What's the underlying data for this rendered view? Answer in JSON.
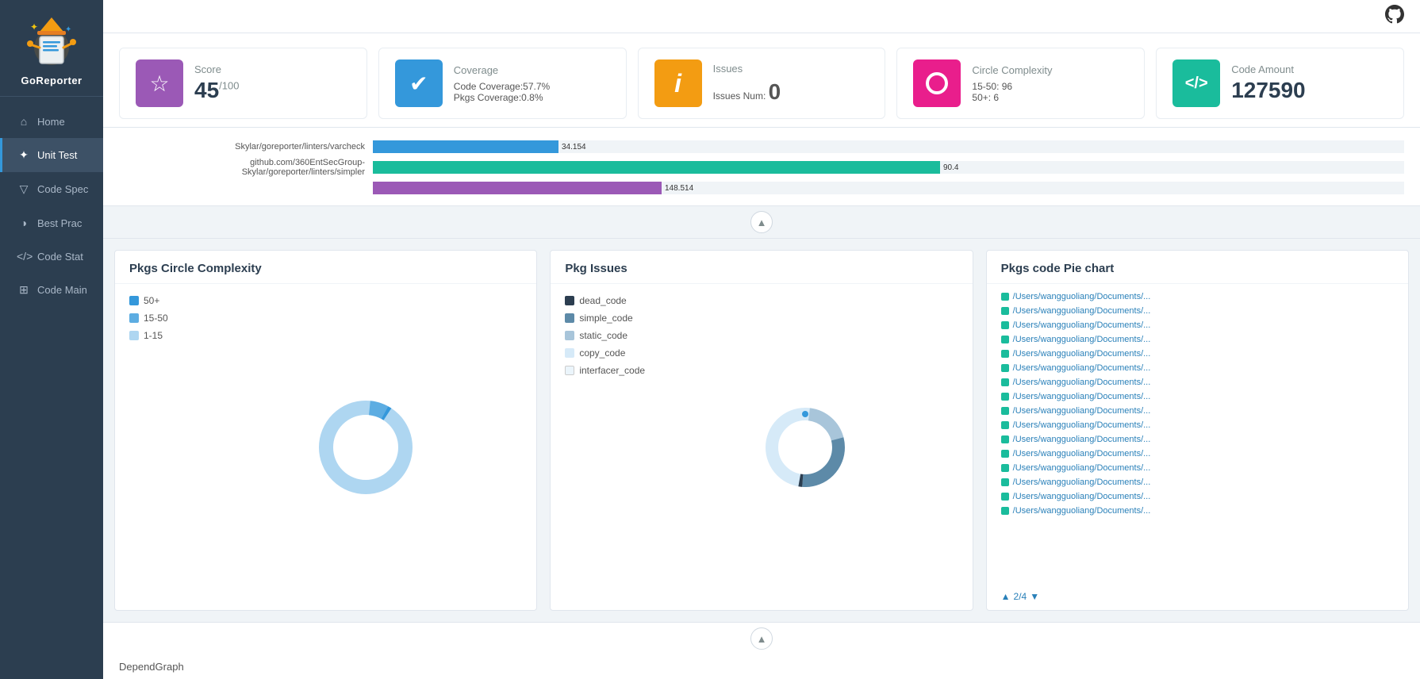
{
  "sidebar": {
    "title": "GoReporter",
    "nav_items": [
      {
        "id": "home",
        "label": "Home",
        "icon": "⌂",
        "active": false
      },
      {
        "id": "unit-test",
        "label": "Unit Test",
        "icon": "✦",
        "active": true
      },
      {
        "id": "code-spec",
        "label": "Code Spec",
        "icon": "▽",
        "active": false
      },
      {
        "id": "best-prac",
        "label": "Best Prac",
        "icon": "◑",
        "active": false
      },
      {
        "id": "code-stat",
        "label": "Code Stat",
        "icon": "</>",
        "active": false
      },
      {
        "id": "code-main",
        "label": "Code Main",
        "icon": "⊞",
        "active": false
      }
    ]
  },
  "topbar": {
    "github_icon": "github"
  },
  "stats": [
    {
      "id": "score",
      "label": "Score",
      "value": "45",
      "sup": "/100",
      "icon": "☆",
      "color": "purple",
      "sub": null
    },
    {
      "id": "coverage",
      "label": "Coverage",
      "value": null,
      "icon": "✔",
      "color": "blue",
      "sub": "Code Coverage:57.7%\nPkgs Coverage:0.8%"
    },
    {
      "id": "issues",
      "label": "Issues",
      "value": "0",
      "icon": "ℹ",
      "color": "orange",
      "sub": "Issues Num:"
    },
    {
      "id": "circle-complexity",
      "label": "Circle Complexity",
      "value": null,
      "icon": "◎",
      "color": "pink",
      "sub": "15-50: 96\n50+: 6"
    },
    {
      "id": "code-amount",
      "label": "Code Amount",
      "value": "127590",
      "icon": "</>",
      "color": "teal",
      "sub": null
    }
  ],
  "bar_chart": {
    "rows": [
      {
        "label": "Skylar/goreporter/linters/varcheck",
        "value": "34.154",
        "width_pct": 18,
        "color": "#3498db"
      },
      {
        "label": "github.com/360EntSecGroup-Skylar/goreporter/linters/simpler",
        "value1": "90.4",
        "value2": "148.514",
        "width1_pct": 55,
        "width2_pct": 28,
        "color1": "#1abc9c",
        "color2": "#9b59b6"
      }
    ]
  },
  "panels": {
    "circle_complexity": {
      "title": "Pkgs Circle Complexity",
      "legend": [
        {
          "label": "50+",
          "color": "#3498db"
        },
        {
          "label": "15-50",
          "color": "#5dade2"
        },
        {
          "label": "1-15",
          "color": "#aed6f1"
        }
      ]
    },
    "pkg_issues": {
      "title": "Pkg Issues",
      "legend": [
        {
          "label": "dead_code",
          "color": "#2c3e50"
        },
        {
          "label": "simple_code",
          "color": "#5d8aa8"
        },
        {
          "label": "static_code",
          "color": "#a8c5da"
        },
        {
          "label": "copy_code",
          "color": "#d6eaf8"
        },
        {
          "label": "interfacer_code",
          "color": "#ebf5fb"
        }
      ]
    },
    "code_pie": {
      "title": "Pkgs code Pie chart",
      "items": [
        "/Users/wangguoliang/Documents/...",
        "/Users/wangguoliang/Documents/...",
        "/Users/wangguoliang/Documents/...",
        "/Users/wangguoliang/Documents/...",
        "/Users/wangguoliang/Documents/...",
        "/Users/wangguoliang/Documents/...",
        "/Users/wangguoliang/Documents/...",
        "/Users/wangguoliang/Documents/...",
        "/Users/wangguoliang/Documents/...",
        "/Users/wangguoliang/Documents/...",
        "/Users/wangguoliang/Documents/...",
        "/Users/wangguoliang/Documents/...",
        "/Users/wangguoliang/Documents/...",
        "/Users/wangguoliang/Documents/...",
        "/Users/wangguoliang/Documents/...",
        "/Users/wangguoliang/Documents/..."
      ],
      "pagination": "2/4"
    }
  },
  "depend_label": "DependGraph",
  "collapse_btn_label": "▲",
  "collapse_btn2_label": "▲"
}
